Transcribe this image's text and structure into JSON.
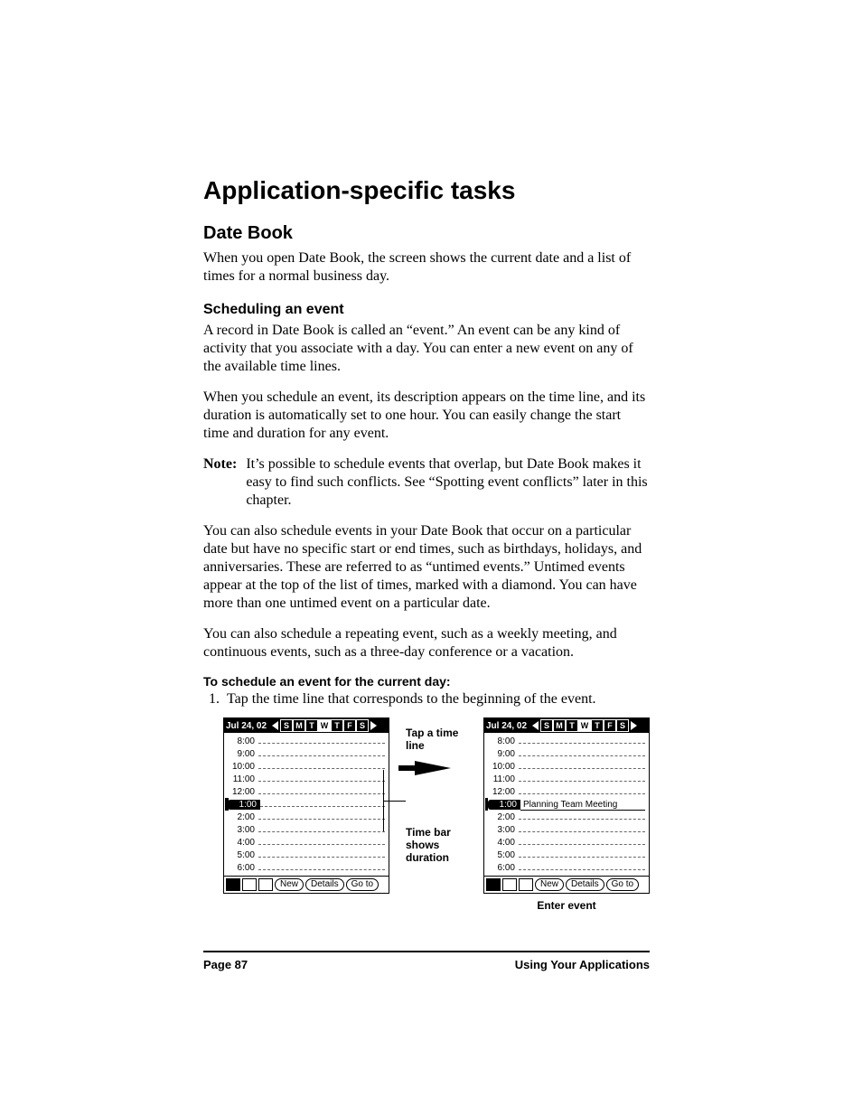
{
  "h1": "Application-specific tasks",
  "h2": "Date Book",
  "intro": "When you open Date Book, the screen shows the current date and a list of times for a normal business day.",
  "h3": "Scheduling an event",
  "p1": "A record in Date Book is called an “event.” An event can be any kind of activity that you associate with a day. You can enter a new event on any of the available time lines.",
  "p2": "When you schedule an event, its description appears on the time line, and its duration is automatically set to one hour. You can easily change the start time and duration for any event.",
  "note_label": "Note:",
  "note_body": "It’s possible to schedule events that overlap, but Date Book makes it easy to find such conflicts. See “Spotting event conflicts” later in this chapter.",
  "p3": "You can also schedule events in your Date Book that occur on a particular date but have no specific start or end times, such as birthdays, holidays, and anniversaries. These are referred to as “untimed events.” Untimed events appear at the top of the list of times, marked with a diamond. You can have more than one untimed event on a particular date.",
  "p4": "You can also schedule a repeating event, such as a weekly meeting, and continuous events, such as a three-day conference or a vacation.",
  "instr_title": "To schedule an event for the current day:",
  "step1": "Tap the time line that corresponds to the beginning of the event.",
  "fig": {
    "date_label": "Jul 24, 02",
    "days": [
      "S",
      "M",
      "T",
      "W",
      "T",
      "F",
      "S"
    ],
    "active_index": 3,
    "hours": [
      "8:00",
      "9:00",
      "10:00",
      "11:00",
      "12:00",
      "1:00",
      "2:00",
      "3:00",
      "4:00",
      "5:00",
      "6:00"
    ],
    "event_text": "Planning Team Meeting",
    "btn_new": "New",
    "btn_details": "Details",
    "btn_goto": "Go to",
    "lbl_tap": "Tap a time line",
    "lbl_timebar": "Time bar shows duration",
    "lbl_enter": "Enter event"
  },
  "footer_left": "Page 87",
  "footer_right": "Using Your Applications"
}
